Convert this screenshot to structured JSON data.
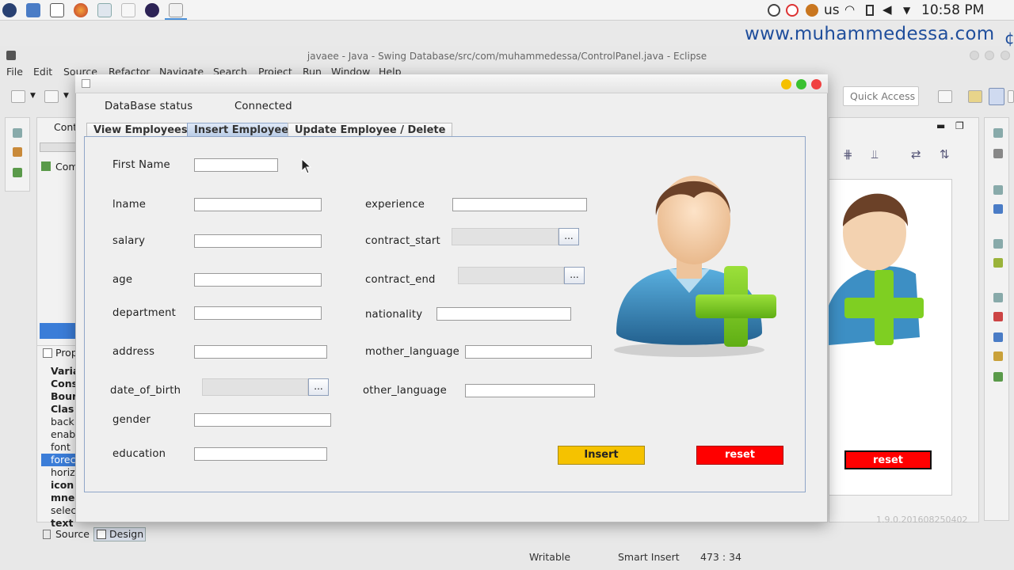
{
  "system_panel": {
    "keyboard_layout": "us",
    "clock": "10:58 PM"
  },
  "watermark": "www.muhammedessa.com",
  "eclipse": {
    "window_title": "javaee - Java - Swing Database/src/com/muhammedessa/ControlPanel.java - Eclipse",
    "menu": [
      "File",
      "Edit",
      "Source",
      "Refactor",
      "Navigate",
      "Search",
      "Project",
      "Run",
      "Window",
      "Help"
    ],
    "quick_access": "Quick Access",
    "editor_tab_label": "Cont",
    "outline_label": "Com",
    "properties_tab": "Prop",
    "properties_rows": [
      "Varia",
      "Cons",
      "Bour",
      "Clas",
      "back",
      "enab",
      "font",
      "forec",
      "horiz",
      "icon",
      "mne",
      "selec",
      "text"
    ],
    "properties_bold": [
      0,
      1,
      2,
      3,
      9,
      10,
      12
    ],
    "properties_selected_index": 7,
    "bottom_tabs": {
      "source": "Source",
      "design": "Design"
    },
    "preview_reset_label": "reset",
    "version_text": "1.9.0.201608250402",
    "status": {
      "writable": "Writable",
      "insert_mode": "Smart Insert",
      "position": "473 : 34"
    }
  },
  "dialog": {
    "db_status_label": "DataBase status",
    "db_status_value": "Connected",
    "tabs": [
      {
        "label": "View Employees",
        "active": false
      },
      {
        "label": "Insert Employee",
        "active": true
      },
      {
        "label": "Update Employee / Delete",
        "active": false
      }
    ],
    "fields_left": {
      "first_name": "First Name",
      "lname": "lname",
      "salary": "salary",
      "age": "age",
      "department": "department",
      "address": "address",
      "date_of_birth": "date_of_birth",
      "gender": "gender",
      "education": "education"
    },
    "fields_right": {
      "experience": "experience",
      "contract_start": "contract_start",
      "contract_end": "contract_end",
      "nationality": "nationality",
      "mother_language": "mother_language",
      "other_language": "other_language"
    },
    "date_button": "...",
    "insert_button": "Insert",
    "reset_button": "reset",
    "colors": {
      "insert": "#f5c200",
      "reset": "#ff0000",
      "plus": "#7fcf22",
      "shirt": "#3d8fc4",
      "hair": "#6b4128"
    }
  }
}
